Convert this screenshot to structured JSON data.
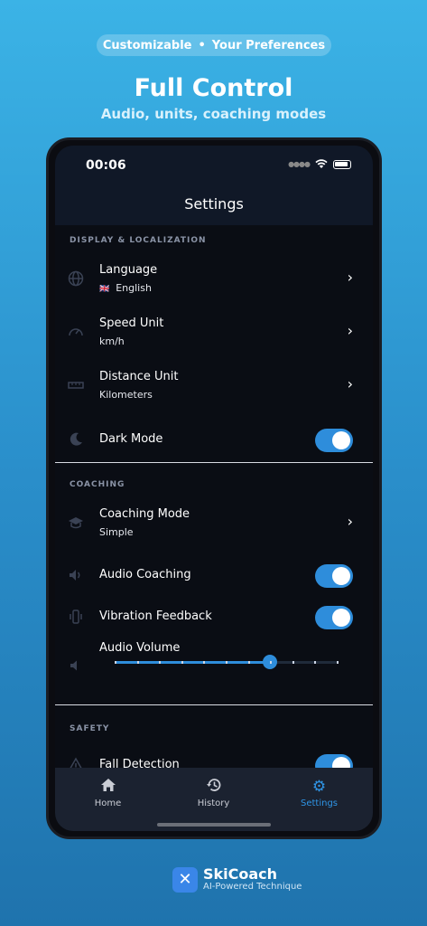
{
  "promo": {
    "pill_left": "Customizable",
    "pill_dot": "•",
    "pill_right": "Your Preferences",
    "headline": "Full Control",
    "subhead": "Audio, units, coaching modes"
  },
  "status_bar": {
    "time": "00:06"
  },
  "header": {
    "title": "Settings"
  },
  "sections": {
    "display": {
      "label": "DISPLAY & LOCALIZATION",
      "language": {
        "label": "Language",
        "value": "English",
        "flag": "🇬🇧",
        "icon": "globe-icon"
      },
      "speed": {
        "label": "Speed Unit",
        "value": "km/h",
        "icon": "speedometer-icon"
      },
      "distance": {
        "label": "Distance Unit",
        "value": "Kilometers",
        "icon": "ruler-icon"
      },
      "dark_mode": {
        "label": "Dark Mode",
        "on": true,
        "icon": "moon-icon"
      }
    },
    "coaching": {
      "label": "COACHING",
      "mode": {
        "label": "Coaching Mode",
        "value": "Simple",
        "icon": "graduation-cap-icon"
      },
      "audio": {
        "label": "Audio Coaching",
        "on": true,
        "icon": "speaker-icon"
      },
      "vibration": {
        "label": "Vibration Feedback",
        "on": true,
        "icon": "vibration-icon"
      },
      "volume": {
        "label": "Audio Volume",
        "value_fraction": 0.7,
        "icon": "volume-icon"
      }
    },
    "safety": {
      "label": "SAFETY",
      "fall": {
        "label": "Fall Detection",
        "on": true,
        "icon": "warning-icon"
      }
    }
  },
  "tabs": [
    {
      "label": "Home",
      "icon": "home-icon",
      "active": false
    },
    {
      "label": "History",
      "icon": "history-icon",
      "active": false
    },
    {
      "label": "Settings",
      "icon": "gear-icon",
      "active": true
    }
  ],
  "brand": {
    "name": "SkiCoach",
    "tagline": "AI-Powered Technique"
  },
  "colors": {
    "accent": "#2e8ddb",
    "background_top": "#3bb3e6",
    "screen": "#0a0d14"
  }
}
